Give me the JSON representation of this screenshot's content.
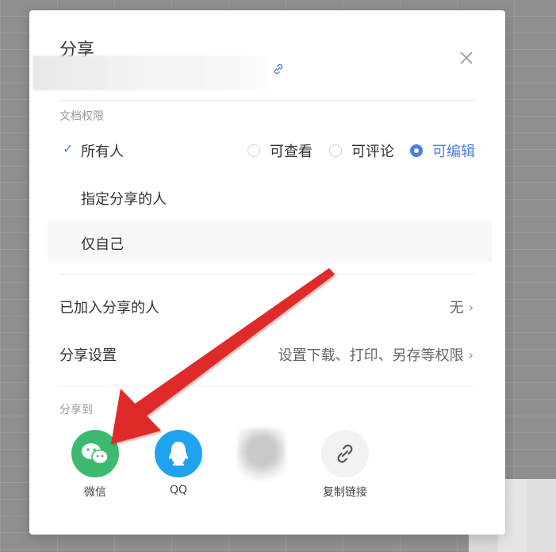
{
  "dialog": {
    "title": "分享",
    "icons": {
      "close": "close-icon",
      "link": "link-icon"
    }
  },
  "permissions": {
    "section_label": "文档权限",
    "options": [
      {
        "label": "所有人",
        "selected": true
      },
      {
        "label": "指定分享的人",
        "selected": false
      },
      {
        "label": "仅自己",
        "selected": false
      }
    ],
    "access_levels": [
      {
        "label": "可查看",
        "selected": false
      },
      {
        "label": "可评论",
        "selected": false
      },
      {
        "label": "可编辑",
        "selected": true
      }
    ]
  },
  "joined": {
    "label": "已加入分享的人",
    "value": "无"
  },
  "settings": {
    "label": "分享设置",
    "value": "设置下载、打印、另存等权限"
  },
  "share_to": {
    "section_label": "分享到",
    "targets": [
      {
        "label": "微信",
        "icon": "wechat-icon",
        "color": "#3dba6f"
      },
      {
        "label": "QQ",
        "icon": "qq-icon",
        "color": "#1fa3ee"
      },
      {
        "label": "复制链接",
        "icon": "copy-link-icon",
        "color": "#f2f2f2"
      }
    ]
  },
  "colors": {
    "accent": "#4a7ee3",
    "annotation_arrow": "#e02a2a"
  }
}
